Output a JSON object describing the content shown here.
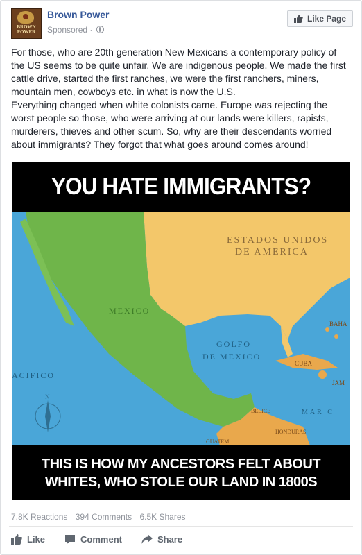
{
  "page": {
    "name": "Brown Power",
    "sponsored_label": "Sponsored ·",
    "avatar_text": "BROWN POWER",
    "like_page_label": "Like Page"
  },
  "post": {
    "paragraph1": "For those, who are 20th generation New Mexicans a contemporary policy of the US seems to be quite unfair. We are indigenous people. We made the first cattle drive, started the first ranches, we were the first ranchers, miners, mountain men, cowboys etc. in what is now the U.S.",
    "paragraph2": "Everything changed when white colonists came. Europe was rejecting the worst people so those, who were arriving at our lands were killers, rapists, murderers, thieves and other scum. So, why are their descendants worried about immigrants? They forgot that what goes around comes around!"
  },
  "image": {
    "top_caption": "YOU HATE IMMIGRANTS?",
    "bottom_caption_line1": "THIS IS HOW MY ANCESTORS FELT ABOUT",
    "bottom_caption_line2": "WHITES, WHO STOLE OUR  LAND IN 1800S",
    "map_labels": {
      "usa_line1": "ESTADOS UNIDOS",
      "usa_line2": "DE AMERICA",
      "mexico": "MEXICO",
      "gulf_line1": "GOLFO",
      "gulf_line2": "DE MEXICO",
      "pacific": "ACIFICO",
      "cuba": "CUBA",
      "bahamas": "BAHA",
      "jamaica": "JAM",
      "caribbean": "MAR C",
      "belize": "BELICE",
      "honduras": "HONDURAS",
      "guatemala": "GUATEM",
      "compass_n": "N"
    },
    "colors": {
      "ocean": "#4aa6d8",
      "usa": "#f3c76a",
      "mexico": "#6fb54a",
      "central_america": "#e9a84c"
    }
  },
  "stats": {
    "reactions": "7.8K Reactions",
    "comments": "394 Comments",
    "shares": "6.5K Shares"
  },
  "actions": {
    "like": "Like",
    "comment": "Comment",
    "share": "Share"
  }
}
